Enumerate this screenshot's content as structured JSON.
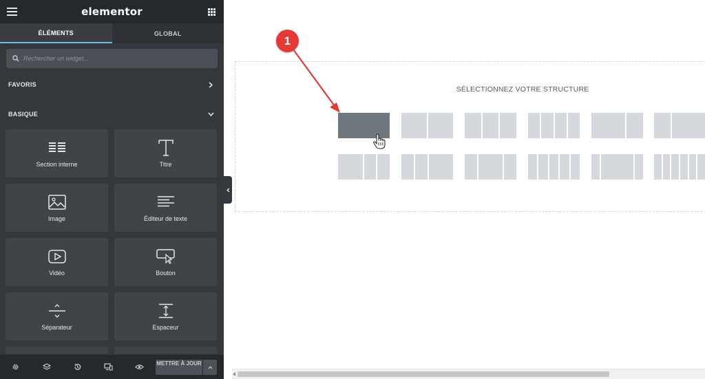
{
  "header": {
    "logo": "elementor"
  },
  "tabs": [
    {
      "label": "ÉLÉMENTS",
      "active": true
    },
    {
      "label": "GLOBAL",
      "active": false
    }
  ],
  "search": {
    "placeholder": "Rechercher un widget..."
  },
  "sections": {
    "favoris": {
      "label": "FAVORIS",
      "state": "collapsed"
    },
    "basique": {
      "label": "BASIQUE",
      "state": "expanded"
    }
  },
  "widgets": [
    {
      "label": "Section interne",
      "icon": "inner-section-icon"
    },
    {
      "label": "Titre",
      "icon": "heading-icon"
    },
    {
      "label": "Image",
      "icon": "image-icon"
    },
    {
      "label": "Éditeur de texte",
      "icon": "text-editor-icon"
    },
    {
      "label": "Vidéo",
      "icon": "video-icon"
    },
    {
      "label": "Bouton",
      "icon": "button-icon"
    },
    {
      "label": "Séparateur",
      "icon": "divider-icon"
    },
    {
      "label": "Espaceur",
      "icon": "spacer-icon"
    }
  ],
  "footer": {
    "icons": [
      "settings-icon",
      "navigator-icon",
      "history-icon",
      "responsive-icon",
      "preview-icon"
    ],
    "publish_label": "METTRE À JOUR"
  },
  "canvas": {
    "title": "SÉLECTIONNEZ VOTRE STRUCTURE",
    "presets": [
      {
        "name": "one-column",
        "columns": 1,
        "selected": true
      },
      {
        "name": "two-columns",
        "columns": 2
      },
      {
        "name": "three-columns",
        "columns": 3
      },
      {
        "name": "four-columns",
        "columns": 4
      },
      {
        "name": "two-thirds-one-third",
        "columns": 2
      },
      {
        "name": "one-third-two-thirds",
        "columns": 2
      },
      {
        "name": "half-quarter-quarter",
        "columns": 3
      },
      {
        "name": "quarter-quarter-half",
        "columns": 3
      },
      {
        "name": "quarter-half-quarter",
        "columns": 3
      },
      {
        "name": "five-columns",
        "columns": 5
      },
      {
        "name": "narrow-wide-narrow",
        "columns": 3
      },
      {
        "name": "six-columns",
        "columns": 6
      }
    ]
  },
  "annotation": {
    "number": "1"
  },
  "colors": {
    "panel": "#34383c",
    "panel_dark": "#26292c",
    "tab_underline": "#66c2e6",
    "preset": "#d5d8dc",
    "preset_selected": "#6f787f",
    "annotation": "#e53935"
  }
}
